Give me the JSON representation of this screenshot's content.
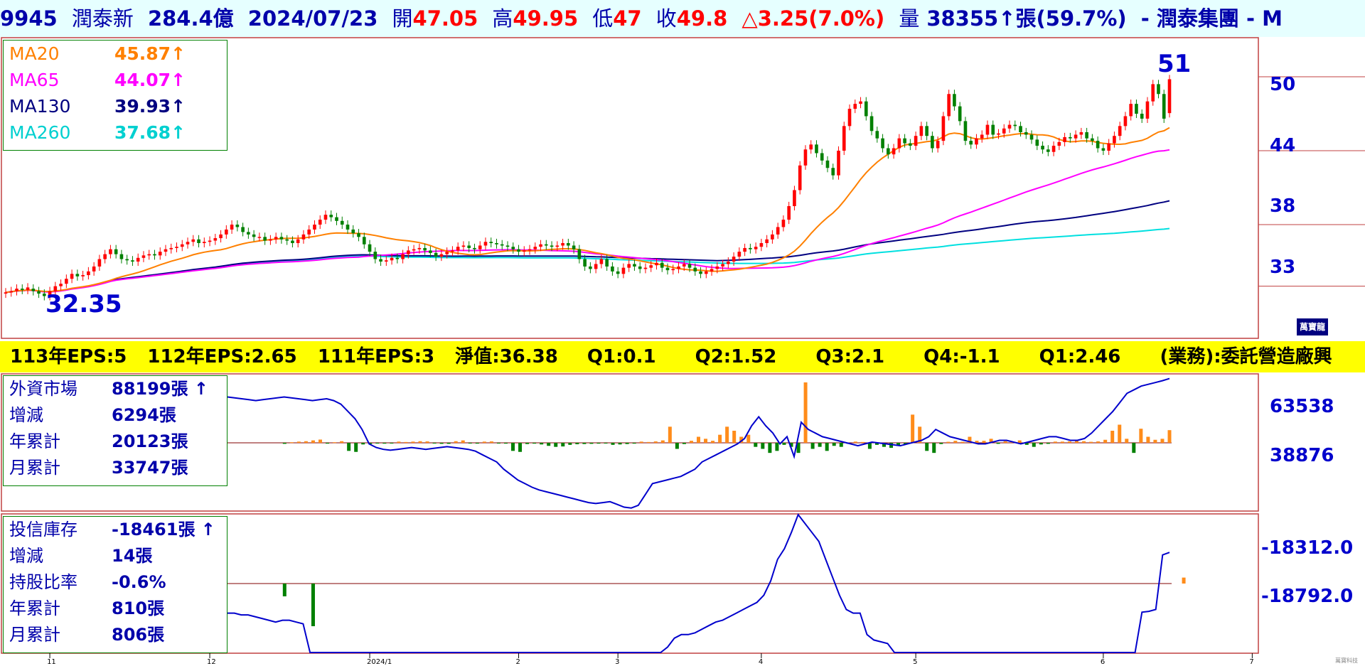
{
  "header": {
    "code": "9945",
    "name": "潤泰新",
    "mktcap": "284.4億",
    "date": "2024/07/23",
    "open_label": "開",
    "open": "47.05",
    "high_label": "高",
    "high": "49.95",
    "low_label": "低",
    "low": "47",
    "close_label": "收",
    "close": "49.8",
    "change": "△3.25(7.0%)",
    "vol_label": "量",
    "volume": "38355↑張(59.7%)",
    "group": "- 潤泰集團 - M"
  },
  "ma_legend": [
    {
      "name": "MA20",
      "value": "45.87↑",
      "color": "#ff8000"
    },
    {
      "name": "MA65",
      "value": "44.07↑",
      "color": "#ff00ff"
    },
    {
      "name": "MA130",
      "value": "39.93↑",
      "color": "#000080"
    },
    {
      "name": "MA260",
      "value": "37.68↑",
      "color": "#00e0e0"
    }
  ],
  "price_extremes": {
    "high": "51",
    "low": "32.35"
  },
  "eps_bar": {
    "eps113": "113年EPS:5",
    "eps112": "112年EPS:2.65",
    "eps111": "111年EPS:3",
    "nav": "淨值:36.38",
    "q1": "Q1:0.1",
    "q2": "Q2:1.52",
    "q3": "Q3:2.1",
    "q4": "Q4:-1.1",
    "q1b": "Q1:2.46",
    "business": "(業務):委託營造廠興"
  },
  "foreign_legend": [
    {
      "name": "外資市場",
      "value": "88199張 ↑"
    },
    {
      "name": "增減",
      "value": "6294張"
    },
    {
      "name": "年累計",
      "value": "20123張"
    },
    {
      "name": "月累計",
      "value": "33747張"
    }
  ],
  "trust_legend": [
    {
      "name": "投信庫存",
      "value": "-18461張 ↑"
    },
    {
      "name": "增減",
      "value": "14張"
    },
    {
      "name": "持股比率",
      "value": "-0.6%"
    },
    {
      "name": "年累計",
      "value": "810張"
    },
    {
      "name": "月累計",
      "value": "806張"
    }
  ],
  "brand": "萬寶龍",
  "footer_brand": "萬寶科技",
  "colors": {
    "up": "#ff0000",
    "down": "#008000",
    "buy": "#ff8c1a",
    "sell": "#008000",
    "line": "#0000cc",
    "header_bg": "#e6ffff"
  },
  "chart_data": [
    {
      "type": "candlestick",
      "title": "9945 潤泰新",
      "price_axis_ticks": [
        "50",
        "44",
        "38",
        "33"
      ],
      "ylim": [
        29,
        53
      ],
      "x_tick_labels": [
        "11",
        "12",
        "2024/1",
        "2",
        "3",
        "4",
        "5",
        "6",
        "7"
      ],
      "x_tick_index": [
        8,
        37,
        66,
        93,
        111,
        137,
        165,
        199,
        226
      ],
      "annotations": {
        "high": 51,
        "low": 32.35
      },
      "closes": [
        32.5,
        32.6,
        32.8,
        32.7,
        32.9,
        32.6,
        32.4,
        32.2,
        32.6,
        33.0,
        33.2,
        33.6,
        34.0,
        33.8,
        33.9,
        34.2,
        34.6,
        35.2,
        35.6,
        36.0,
        35.6,
        35.2,
        35.1,
        35.0,
        35.3,
        35.5,
        35.6,
        35.5,
        35.8,
        36.0,
        36.1,
        36.2,
        36.4,
        36.6,
        36.8,
        36.5,
        36.6,
        36.7,
        36.9,
        37.2,
        37.6,
        38.0,
        37.8,
        37.4,
        37.2,
        37.0,
        37.0,
        36.7,
        36.8,
        37.0,
        36.8,
        36.7,
        36.5,
        36.8,
        37.2,
        37.6,
        38.0,
        38.4,
        38.8,
        38.6,
        38.3,
        38.0,
        37.6,
        37.3,
        37.0,
        36.4,
        35.8,
        35.2,
        35.0,
        35.1,
        35.3,
        35.2,
        35.6,
        35.9,
        36.0,
        36.1,
        35.9,
        35.7,
        35.4,
        35.6,
        35.8,
        35.9,
        36.2,
        36.3,
        36.1,
        36.0,
        36.3,
        36.6,
        36.5,
        36.4,
        36.3,
        36.2,
        36.0,
        35.8,
        35.9,
        36.0,
        36.2,
        36.4,
        36.3,
        36.2,
        36.3,
        36.5,
        36.3,
        36.0,
        35.2,
        34.6,
        34.4,
        34.8,
        35.2,
        34.6,
        34.2,
        34.0,
        34.5,
        34.8,
        34.6,
        34.4,
        34.5,
        34.7,
        34.9,
        34.5,
        34.3,
        34.4,
        34.6,
        34.8,
        34.5,
        34.2,
        34.0,
        34.2,
        34.4,
        34.6,
        34.8,
        35.0,
        35.4,
        35.8,
        36.1,
        36.0,
        36.2,
        36.5,
        36.8,
        37.2,
        37.8,
        38.4,
        39.5,
        40.8,
        42.8,
        44.1,
        44.5,
        43.8,
        43.2,
        42.6,
        42.0,
        44.0,
        46.0,
        47.4,
        47.8,
        48.0,
        46.8,
        45.6,
        45.0,
        44.2,
        43.7,
        44.2,
        45.0,
        44.6,
        44.4,
        45.2,
        46.0,
        45.2,
        44.2,
        44.8,
        46.8,
        48.6,
        47.6,
        46.4,
        44.8,
        44.5,
        45.0,
        45.3,
        46.1,
        45.3,
        45.4,
        45.8,
        46.1,
        46.0,
        45.5,
        45.3,
        44.9,
        44.4,
        44.1,
        43.9,
        44.4,
        44.7,
        45.1,
        45.0,
        45.3,
        45.5,
        45.0,
        44.8,
        44.2,
        44.0,
        44.6,
        45.2,
        46.0,
        46.8,
        47.8,
        47.0,
        46.6,
        48.0,
        49.4,
        48.6,
        46.6,
        49.8
      ],
      "opens": [
        32.4,
        32.5,
        32.6,
        32.8,
        32.7,
        32.8,
        32.6,
        32.4,
        32.2,
        32.6,
        33.0,
        33.2,
        33.6,
        34.0,
        33.8,
        33.9,
        34.2,
        34.6,
        35.2,
        35.6,
        36.0,
        35.6,
        35.2,
        35.1,
        35.0,
        35.3,
        35.5,
        35.6,
        35.5,
        35.8,
        36.0,
        36.1,
        36.2,
        36.4,
        36.6,
        36.8,
        36.5,
        36.6,
        36.7,
        36.9,
        37.2,
        37.6,
        38.0,
        37.8,
        37.4,
        37.2,
        37.0,
        37.0,
        36.7,
        36.8,
        37.0,
        36.8,
        36.7,
        36.5,
        36.8,
        37.2,
        37.6,
        38.0,
        38.4,
        38.8,
        38.6,
        38.3,
        38.0,
        37.6,
        37.3,
        37.0,
        36.4,
        35.8,
        35.2,
        35.0,
        35.1,
        35.3,
        35.2,
        35.6,
        35.9,
        36.0,
        36.1,
        35.9,
        35.7,
        35.4,
        35.6,
        35.8,
        35.9,
        36.2,
        36.3,
        36.1,
        36.0,
        36.3,
        36.6,
        36.5,
        36.4,
        36.3,
        36.2,
        36.0,
        35.8,
        35.9,
        36.0,
        36.2,
        36.4,
        36.3,
        36.2,
        36.3,
        36.5,
        36.3,
        36.0,
        35.2,
        34.6,
        34.4,
        34.8,
        35.2,
        34.6,
        34.2,
        34.0,
        34.5,
        34.8,
        34.6,
        34.4,
        34.5,
        34.7,
        34.9,
        34.5,
        34.3,
        34.4,
        34.6,
        34.8,
        34.5,
        34.2,
        34.0,
        34.2,
        34.4,
        34.6,
        34.8,
        35.0,
        35.4,
        35.8,
        36.1,
        36.0,
        36.2,
        36.5,
        36.8,
        37.2,
        37.8,
        38.4,
        39.5,
        40.8,
        42.8,
        44.1,
        44.5,
        43.8,
        43.2,
        42.6,
        42.0,
        44.0,
        46.0,
        47.4,
        47.8,
        48.0,
        46.8,
        45.6,
        45.0,
        44.2,
        43.7,
        44.2,
        45.0,
        44.6,
        44.4,
        45.2,
        46.0,
        45.2,
        44.2,
        44.8,
        46.8,
        48.6,
        47.6,
        46.4,
        44.8,
        44.5,
        45.0,
        45.3,
        46.1,
        45.3,
        45.4,
        45.8,
        46.1,
        46.0,
        45.5,
        45.3,
        44.9,
        44.4,
        44.1,
        43.9,
        44.4,
        44.7,
        45.1,
        45.0,
        45.3,
        45.5,
        45.0,
        44.8,
        44.2,
        44.0,
        44.6,
        45.2,
        46.0,
        46.8,
        47.8,
        47.0,
        46.6,
        48.0,
        49.4,
        48.6,
        47.05
      ],
      "ma20_end": 45.87,
      "ma65_end": 44.07,
      "ma130_end": 39.93,
      "ma260_end": 37.68
    },
    {
      "type": "bar+line",
      "title": "外資市場",
      "axis_ticks": [
        "63538",
        "38876"
      ],
      "holding_path": [
        78000,
        77500,
        77000,
        76500,
        76000,
        76500,
        77000,
        77500,
        78000,
        77500,
        77000,
        76500,
        76000,
        76500,
        77000,
        76000,
        74000,
        70000,
        66000,
        60000,
        52000,
        50000,
        49000,
        48500,
        49000,
        49500,
        50000,
        49500,
        49000,
        49500,
        50000,
        50500,
        50000,
        49500,
        49000,
        48000,
        46000,
        44000,
        42000,
        38000,
        35000,
        32000,
        30000,
        28000,
        26500,
        25500,
        24500,
        23500,
        22500,
        21500,
        20500,
        19500,
        19000,
        19500,
        20000,
        18500,
        17000,
        16500,
        18000,
        24000,
        30000,
        31000,
        32000,
        33000,
        34000,
        36000,
        38000,
        42000,
        44000,
        46000,
        48000,
        50000,
        52000,
        55000,
        62000,
        67000,
        62000,
        58000,
        52000,
        56000,
        45000,
        64000,
        60000,
        58000,
        56000,
        55000,
        54000,
        53000,
        52000,
        51000,
        52000,
        53000,
        52500,
        52000,
        51500,
        51000,
        52000,
        53000,
        54000,
        56000,
        60000,
        58000,
        56000,
        55000,
        54000,
        53000,
        52000,
        52000,
        53000,
        54000,
        54000,
        53000,
        52000,
        53000,
        54000,
        55000,
        56000,
        56000,
        55000,
        54000,
        54000,
        55000,
        58000,
        62000,
        66000,
        70000,
        75000,
        80000,
        82000,
        84000,
        85000,
        86000,
        87000,
        88199
      ],
      "daily_net": [
        0,
        0,
        0,
        0,
        0,
        0,
        0,
        0,
        -500,
        300,
        600,
        800,
        1200,
        1600,
        -400,
        300,
        800,
        -4000,
        -4500,
        -800,
        -600,
        -300,
        -400,
        -200,
        600,
        400,
        600,
        800,
        700,
        -300,
        -500,
        -500,
        800,
        1200,
        -300,
        -400,
        600,
        700,
        -300,
        -400,
        -4000,
        -4500,
        -600,
        -400,
        -800,
        -1500,
        -2000,
        -1800,
        -1000,
        -700,
        -600,
        -500,
        -400,
        -300,
        -1000,
        -800,
        -600,
        -400,
        600,
        400,
        700,
        1200,
        8000,
        -3000,
        -600,
        1000,
        3000,
        2000,
        1000,
        4000,
        8000,
        6000,
        3000,
        4000,
        -2000,
        -3000,
        -5000,
        -4000,
        -1000,
        -2000,
        -5000,
        30000,
        -3000,
        -2000,
        -4000,
        -1500,
        -2000,
        -500,
        600,
        400,
        -3000,
        -1000,
        -2000,
        -2500,
        -1500,
        -800,
        14000,
        8000,
        -4000,
        -5000,
        -600,
        500,
        1000,
        500,
        3000,
        1000,
        1000,
        2000,
        -500,
        800,
        400,
        1200,
        -1000,
        -2000,
        -800,
        -500,
        600,
        600,
        700,
        900,
        800,
        500,
        700,
        1500,
        6000,
        9000,
        2000,
        -5000,
        7000,
        3000,
        1500,
        2000,
        6294
      ]
    },
    {
      "type": "bar+line",
      "title": "投信庫存",
      "axis_ticks": [
        "-18312.0",
        "-18792.0"
      ],
      "inventory_path": [
        -18800,
        -18800,
        -18810,
        -18810,
        -18820,
        -18830,
        -18840,
        -18850,
        -18840,
        -18840,
        -18850,
        -18860,
        -19020,
        -19020,
        -19020,
        -19020,
        -19020,
        -19020,
        -19020,
        -19020,
        -19020,
        -19020,
        -19020,
        -19020,
        -19020,
        -19020,
        -19020,
        -19020,
        -19020,
        -19020,
        -19020,
        -19020,
        -19020,
        -19020,
        -19020,
        -19020,
        -19020,
        -19020,
        -19020,
        -19020,
        -19020,
        -19020,
        -19020,
        -19020,
        -19020,
        -19020,
        -19020,
        -19020,
        -19020,
        -19020,
        -19020,
        -19020,
        -19020,
        -19020,
        -19020,
        -19020,
        -19020,
        -19020,
        -19020,
        -19020,
        -19020,
        -19020,
        -19020,
        -19020,
        -18990,
        -18940,
        -18920,
        -18920,
        -18910,
        -18890,
        -18870,
        -18850,
        -18840,
        -18820,
        -18800,
        -18780,
        -18760,
        -18740,
        -18700,
        -18620,
        -18500,
        -18440,
        -18350,
        -18250,
        -18300,
        -18350,
        -18400,
        -18500,
        -18600,
        -18700,
        -18780,
        -18800,
        -18800,
        -18920,
        -18950,
        -18960,
        -18970,
        -19020,
        -19020,
        -19020,
        -19020,
        -19020,
        -19020,
        -19020,
        -19020,
        -19020,
        -19020,
        -19020,
        -19020,
        -19020,
        -19020,
        -19020,
        -19020,
        -19020,
        -19020,
        -19020,
        -19020,
        -19020,
        -19020,
        -19020,
        -19020,
        -19020,
        -19020,
        -19020,
        -19020,
        -19020,
        -19020,
        -19020,
        -19020,
        -19020,
        -19020,
        -19020,
        -19020,
        -18795,
        -18790,
        -18780,
        -18475,
        -18461
      ],
      "daily_net": [
        0,
        0,
        0,
        0,
        0,
        0,
        0,
        0,
        -30,
        0,
        0,
        0,
        -100,
        0,
        0,
        0,
        0,
        0,
        0,
        0,
        0,
        0,
        0,
        0,
        0,
        0,
        0,
        0,
        0,
        0,
        0,
        0,
        0,
        0,
        0,
        0,
        0,
        0,
        0,
        0,
        0,
        0,
        0,
        0,
        0,
        0,
        0,
        0,
        0,
        0,
        0,
        0,
        0,
        0,
        0,
        0,
        0,
        0,
        0,
        0,
        0,
        0,
        0,
        0,
        0,
        0,
        0,
        0,
        0,
        0,
        0,
        0,
        0,
        0,
        0,
        0,
        0,
        0,
        0,
        0,
        0,
        0,
        0,
        0,
        0,
        0,
        0,
        0,
        0,
        0,
        0,
        0,
        0,
        0,
        0,
        0,
        0,
        0,
        0,
        0,
        0,
        0,
        0,
        0,
        0,
        0,
        0,
        0,
        0,
        0,
        0,
        0,
        0,
        0,
        0,
        0,
        0,
        0,
        0,
        0,
        0,
        0,
        0,
        0,
        0,
        0,
        0,
        0,
        0,
        0,
        0,
        0,
        0,
        0,
        14
      ]
    }
  ]
}
